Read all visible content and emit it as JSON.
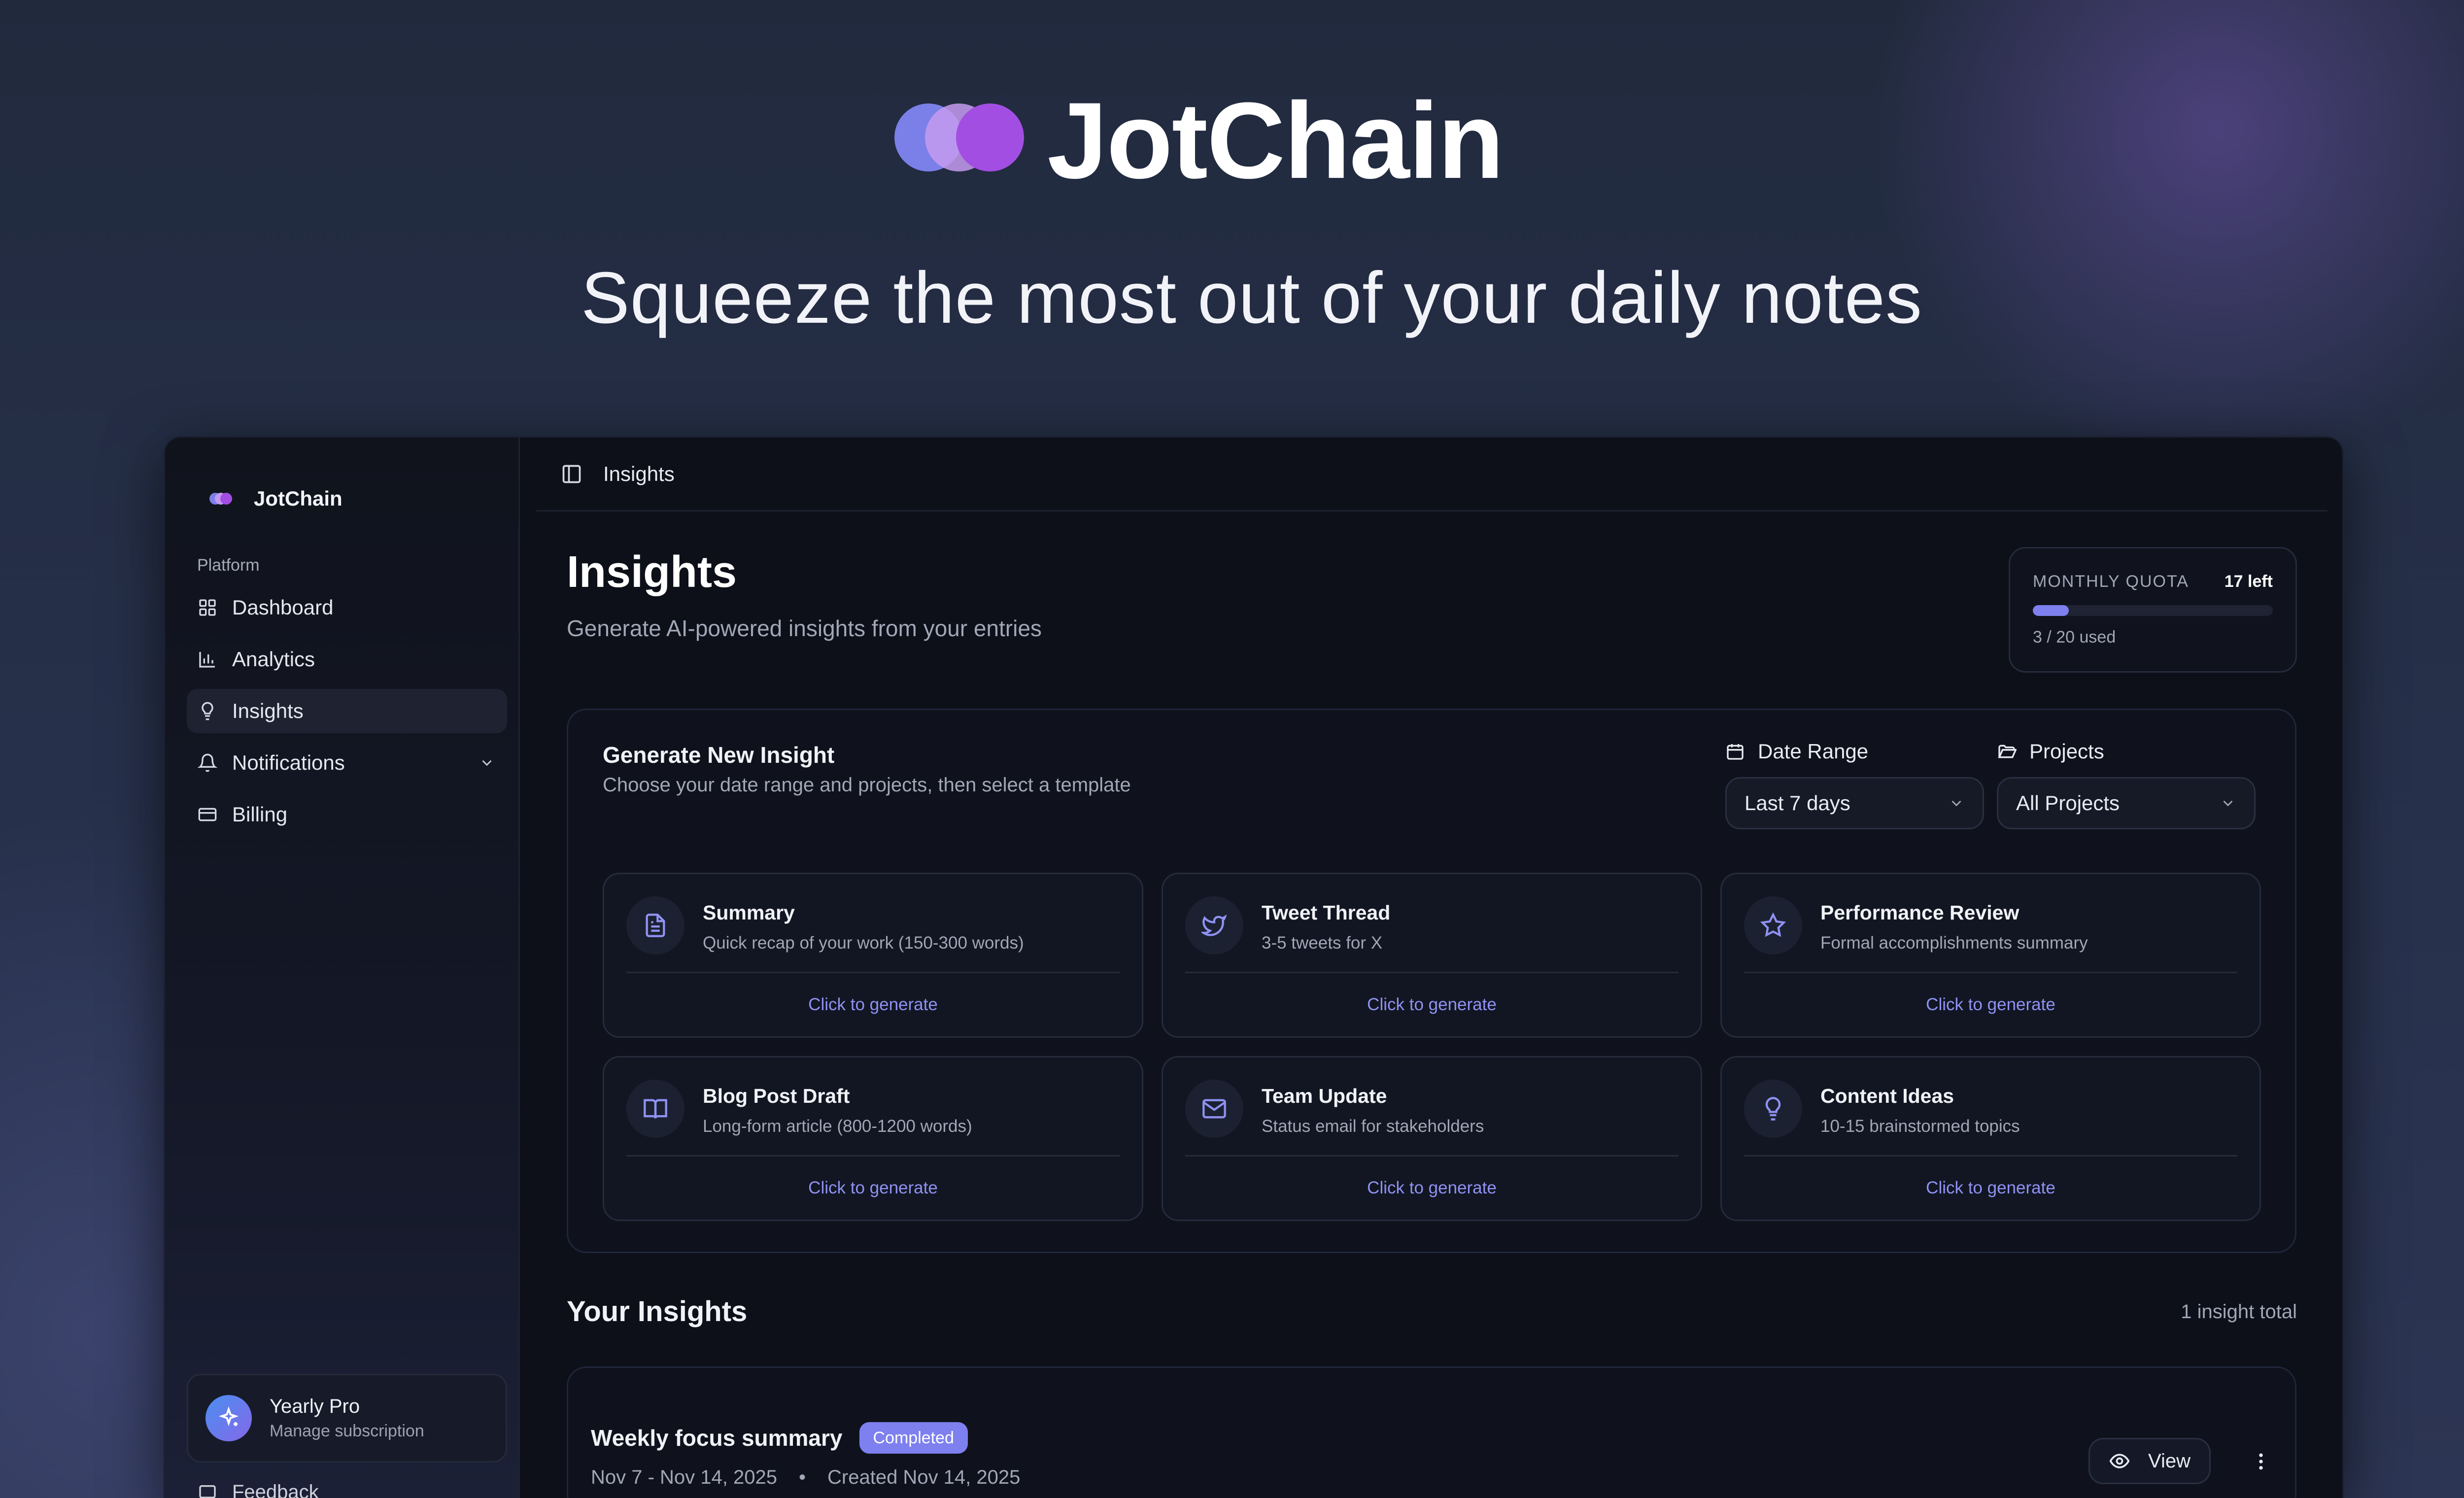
{
  "hero": {
    "brand": "JotChain",
    "tagline": "Squeeze the most out of your daily notes"
  },
  "colors": {
    "accent": "#7d80ee",
    "brand_purple": "#a34ee3",
    "window_bg": "#0d1019"
  },
  "sidebar": {
    "brand": "JotChain",
    "section_label": "Platform",
    "items": [
      {
        "label": "Dashboard",
        "icon": "grid-icon"
      },
      {
        "label": "Analytics",
        "icon": "bar-chart-icon"
      },
      {
        "label": "Insights",
        "icon": "lightbulb-icon",
        "active": true
      },
      {
        "label": "Notifications",
        "icon": "bell-icon",
        "expandable": true
      },
      {
        "label": "Billing",
        "icon": "credit-card-icon"
      }
    ],
    "plan": {
      "title": "Yearly Pro",
      "subtitle": "Manage subscription",
      "icon": "sparkle-icon"
    },
    "feedback": "Feedback"
  },
  "topbar": {
    "breadcrumb": "Insights",
    "icon": "sidebar-toggle-icon"
  },
  "header": {
    "title": "Insights",
    "subtitle": "Generate AI-powered insights from your entries"
  },
  "quota": {
    "label": "MONTHLY QUOTA",
    "remaining": "17 left",
    "used_text": "3 / 20 used",
    "used": 3,
    "total": 20
  },
  "generator": {
    "title": "Generate New Insight",
    "subtitle": "Choose your date range and projects, then select a template",
    "date_range": {
      "label": "Date Range",
      "value": "Last 7 days",
      "icon": "calendar-icon"
    },
    "projects": {
      "label": "Projects",
      "value": "All Projects",
      "icon": "folder-icon"
    },
    "templates": [
      {
        "name": "Summary",
        "desc": "Quick recap of your work (150-300 words)",
        "cta": "Click to generate",
        "icon": "document-icon"
      },
      {
        "name": "Tweet Thread",
        "desc": "3-5 tweets for X",
        "cta": "Click to generate",
        "icon": "twitter-icon"
      },
      {
        "name": "Performance Review",
        "desc": "Formal accomplishments summary",
        "cta": "Click to generate",
        "icon": "star-icon"
      },
      {
        "name": "Blog Post Draft",
        "desc": "Long-form article (800-1200 words)",
        "cta": "Click to generate",
        "icon": "book-icon"
      },
      {
        "name": "Team Update",
        "desc": "Status email for stakeholders",
        "cta": "Click to generate",
        "icon": "mail-icon"
      },
      {
        "name": "Content Ideas",
        "desc": "10-15 brainstormed topics",
        "cta": "Click to generate",
        "icon": "lightbulb-icon"
      }
    ]
  },
  "your_insights": {
    "title": "Your Insights",
    "count": "1 insight total",
    "items": [
      {
        "title": "Weekly focus summary",
        "status": "Completed",
        "range": "Nov 7 - Nov 14, 2025",
        "created": "Created Nov 14, 2025",
        "view_label": "View"
      }
    ]
  }
}
